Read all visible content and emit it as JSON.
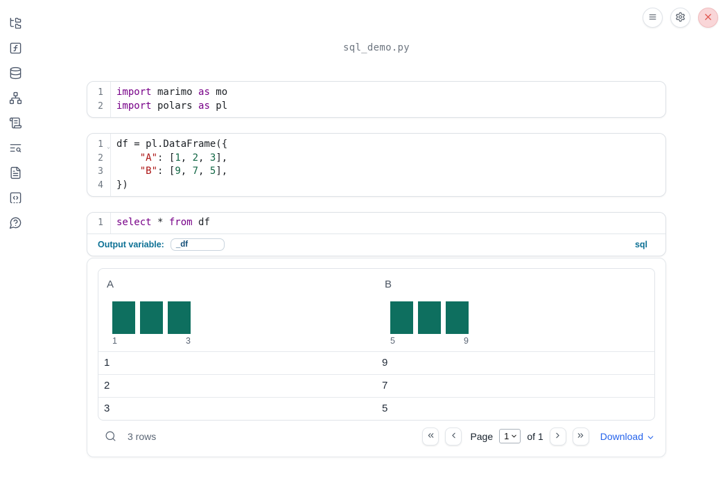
{
  "app": {
    "filename": "sql_demo.py"
  },
  "colors": {
    "keyword": "#770088",
    "string": "#aa1111",
    "number": "#116644",
    "histogram_bar": "#0e6f5f",
    "sql_accent": "#0c7094",
    "download_link": "#2563eb",
    "close_red": "#e0564f"
  },
  "sidebar": {
    "items": [
      {
        "name": "sidebar-item-file-explorer",
        "icon": "folder-tree"
      },
      {
        "name": "sidebar-item-variables",
        "icon": "function-square"
      },
      {
        "name": "sidebar-item-datasources",
        "icon": "database"
      },
      {
        "name": "sidebar-item-dependencies",
        "icon": "network"
      },
      {
        "name": "sidebar-item-scratchpad",
        "icon": "scroll-text"
      },
      {
        "name": "sidebar-item-logs",
        "icon": "text-search"
      },
      {
        "name": "sidebar-item-documentation",
        "icon": "file-text"
      },
      {
        "name": "sidebar-item-snippets",
        "icon": "square-code"
      },
      {
        "name": "sidebar-item-help",
        "icon": "circle-help"
      }
    ]
  },
  "topbar": {
    "buttons": [
      {
        "name": "notebook-menu-button",
        "icon": "menu"
      },
      {
        "name": "settings-button",
        "icon": "settings"
      },
      {
        "name": "shutdown-button",
        "icon": "close"
      }
    ]
  },
  "cells": [
    {
      "id": "imports",
      "lines": [
        {
          "n": "1",
          "tokens": [
            {
              "s": "kw",
              "t": "import"
            },
            {
              "s": "pl",
              "t": " marimo "
            },
            {
              "s": "kw",
              "t": "as"
            },
            {
              "s": "pl",
              "t": " mo"
            }
          ]
        },
        {
          "n": "2",
          "tokens": [
            {
              "s": "kw",
              "t": "import"
            },
            {
              "s": "pl",
              "t": " polars "
            },
            {
              "s": "kw",
              "t": "as"
            },
            {
              "s": "pl",
              "t": " pl"
            }
          ]
        }
      ]
    },
    {
      "id": "dataframe",
      "lines": [
        {
          "n": "1",
          "fold": true,
          "tokens": [
            {
              "s": "pl",
              "t": "df = pl.DataFrame({"
            }
          ]
        },
        {
          "n": "2",
          "tokens": [
            {
              "s": "pl",
              "t": "    "
            },
            {
              "s": "str",
              "t": "\"A\""
            },
            {
              "s": "pl",
              "t": ": ["
            },
            {
              "s": "num",
              "t": "1"
            },
            {
              "s": "pl",
              "t": ", "
            },
            {
              "s": "num",
              "t": "2"
            },
            {
              "s": "pl",
              "t": ", "
            },
            {
              "s": "num",
              "t": "3"
            },
            {
              "s": "pl",
              "t": "],"
            }
          ]
        },
        {
          "n": "3",
          "tokens": [
            {
              "s": "pl",
              "t": "    "
            },
            {
              "s": "str",
              "t": "\"B\""
            },
            {
              "s": "pl",
              "t": ": ["
            },
            {
              "s": "num",
              "t": "9"
            },
            {
              "s": "pl",
              "t": ", "
            },
            {
              "s": "num",
              "t": "7"
            },
            {
              "s": "pl",
              "t": ", "
            },
            {
              "s": "num",
              "t": "5"
            },
            {
              "s": "pl",
              "t": "],"
            }
          ]
        },
        {
          "n": "4",
          "tokens": [
            {
              "s": "pl",
              "t": "})"
            }
          ]
        }
      ]
    },
    {
      "id": "sql",
      "lines": [
        {
          "n": "1",
          "tokens": [
            {
              "s": "kw",
              "t": "select"
            },
            {
              "s": "pl",
              "t": " * "
            },
            {
              "s": "kw",
              "t": "from"
            },
            {
              "s": "pl",
              "t": " df"
            }
          ]
        }
      ]
    }
  ],
  "sql_cell": {
    "output_variable_label": "Output variable:",
    "output_variable_value": "_df",
    "language_badge": "sql"
  },
  "table": {
    "columns": [
      {
        "name": "A",
        "histogram": {
          "bar_heights": [
            1,
            1,
            1
          ],
          "min_label": "1",
          "max_label": "3"
        }
      },
      {
        "name": "B",
        "histogram": {
          "bar_heights": [
            1,
            1,
            1
          ],
          "min_label": "5",
          "max_label": "9"
        }
      }
    ],
    "rows": [
      [
        "1",
        "9"
      ],
      [
        "2",
        "7"
      ],
      [
        "3",
        "5"
      ]
    ],
    "footer": {
      "row_count": "3 rows",
      "page_label": "Page",
      "page_value": "1",
      "of_label": "of 1",
      "download_label": "Download"
    }
  }
}
